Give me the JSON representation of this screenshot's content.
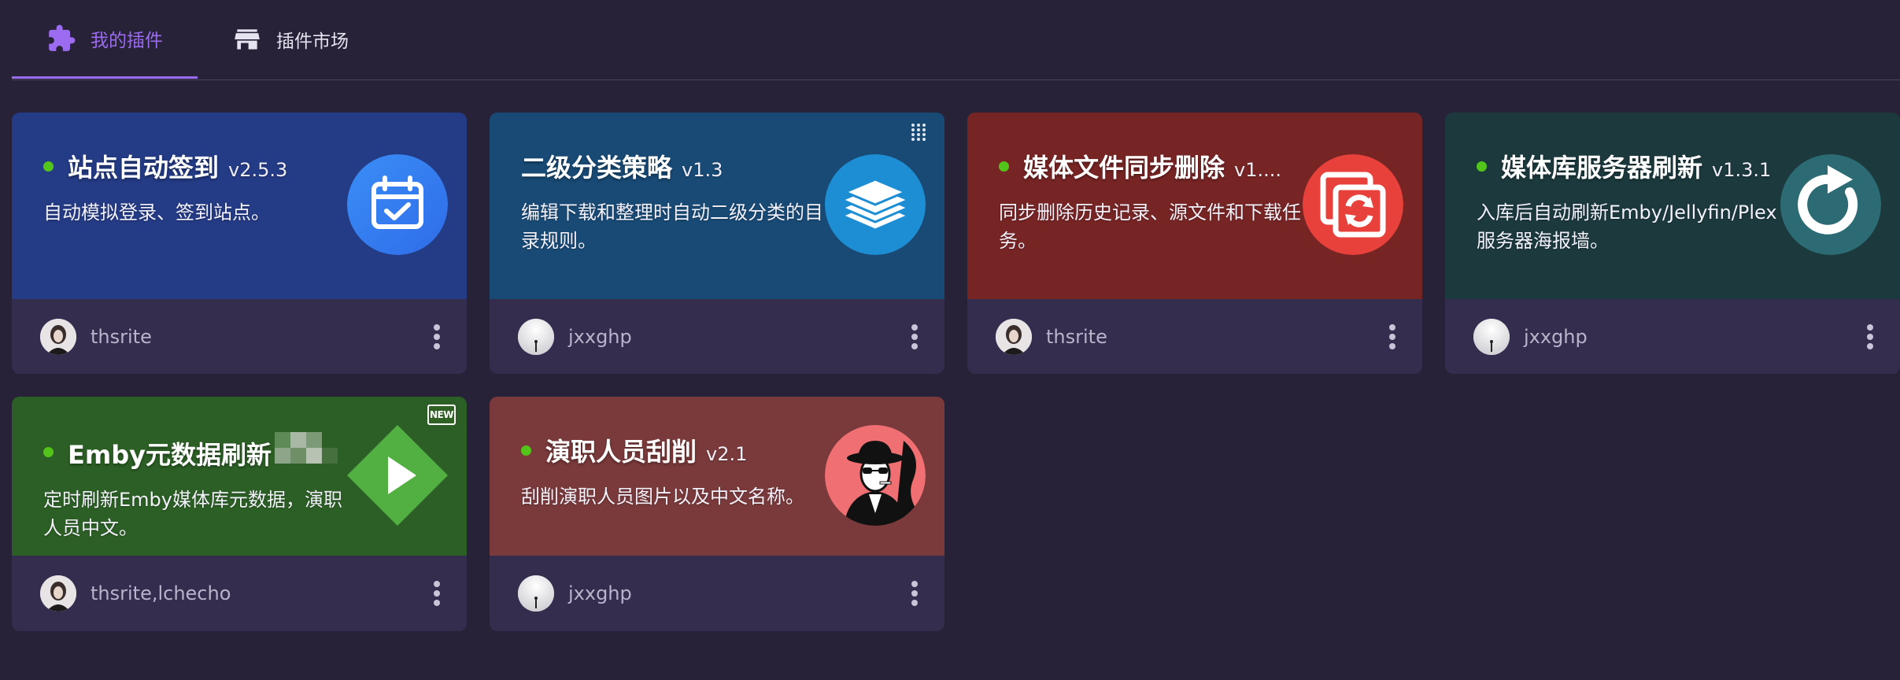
{
  "tabs": [
    {
      "label": "我的插件",
      "icon": "puzzle-icon",
      "active": true
    },
    {
      "label": "插件市场",
      "icon": "store-icon",
      "active": false
    }
  ],
  "colors": {
    "background": "#272238",
    "accent": "#9b6cf0",
    "status_active": "#52c41a",
    "card_bottom": "#342d4e"
  },
  "plugins": [
    {
      "title": "站点自动签到",
      "version": "v2.5.3",
      "description": "自动模拟登录、签到站点。",
      "author": "thsrite",
      "enabled": true,
      "color": "#243b85",
      "icon": "calendar-check-icon"
    },
    {
      "title": "二级分类策略",
      "version": "v1.3",
      "description": "编辑下载和整理时自动二级分类的目录规则。",
      "author": "jxxghp",
      "enabled": false,
      "color": "#184a75",
      "icon": "stacked-layers-icon"
    },
    {
      "title": "媒体文件同步删除",
      "version": "v1....",
      "description": "同步删除历史记录、源文件和下载任务。",
      "author": "thsrite",
      "enabled": true,
      "color": "#772524",
      "icon": "sync-files-icon"
    },
    {
      "title": "媒体库服务器刷新",
      "version": "v1.3.1",
      "description": "入库后自动刷新Emby/Jellyfin/Plex服务器海报墙。",
      "author": "jxxghp",
      "enabled": true,
      "color": "#1c3a3e",
      "icon": "refresh-icon"
    },
    {
      "title": "Emby元数据刷新",
      "version": "",
      "description": "定时刷新Emby媒体库元数据，演职人员中文。",
      "author": "thsrite,lchecho",
      "enabled": true,
      "color": "#2c5f25",
      "icon": "emby-play-icon",
      "badge": "NEW"
    },
    {
      "title": "演职人员刮削",
      "version": "v2.1",
      "description": "刮削演职人员图片以及中文名称。",
      "author": "jxxghp",
      "enabled": true,
      "color": "#7a3a3b",
      "icon": "actor-portrait-icon"
    }
  ]
}
